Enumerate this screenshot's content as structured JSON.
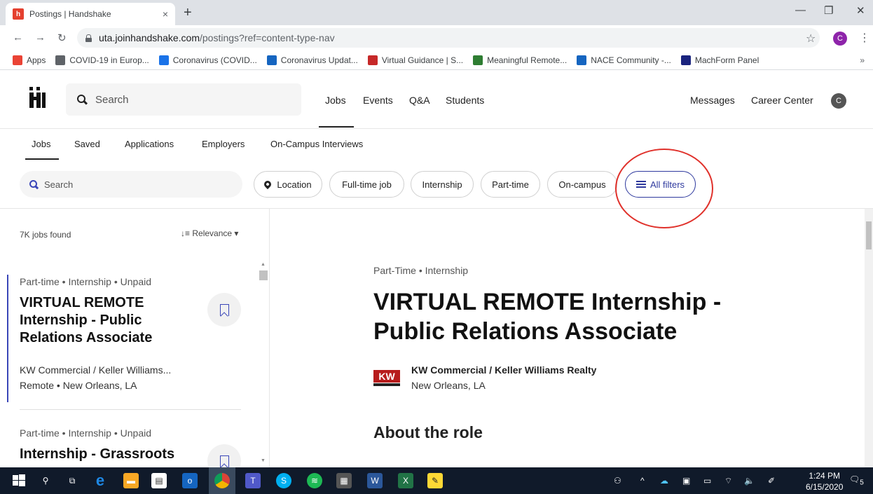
{
  "browser": {
    "tab_title": "Postings | Handshake",
    "tab_close": "×",
    "new_tab": "+",
    "url_domain": "uta.joinhandshake.com",
    "url_path": "/postings?ref=content-type-nav",
    "profile_initial": "C",
    "bookmarks": [
      {
        "label": "Apps",
        "icon": "apps-grid-icon",
        "color": "#ea4335"
      },
      {
        "label": "COVID-19 in Europ...",
        "icon": "globe-icon",
        "color": "#5f6368"
      },
      {
        "label": "Coronavirus (COVID...",
        "icon": "who-icon",
        "color": "#1a73e8"
      },
      {
        "label": "Coronavirus Updat...",
        "icon": "star-badge-icon",
        "color": "#1565c0"
      },
      {
        "label": "Virtual Guidance | S...",
        "icon": "shield-icon",
        "color": "#c62828"
      },
      {
        "label": "Meaningful Remote...",
        "icon": "state-icon",
        "color": "#2e7d32"
      },
      {
        "label": "NACE Community -...",
        "icon": "nace-icon",
        "color": "#1565c0"
      },
      {
        "label": "MachForm Panel",
        "icon": "machform-icon",
        "color": "#1a237e"
      }
    ],
    "bookmarks_more": "»"
  },
  "header": {
    "search_placeholder": "Search",
    "nav": [
      "Jobs",
      "Events",
      "Q&A",
      "Students"
    ],
    "messages": "Messages",
    "career_center": "Career Center",
    "avatar_initial": "C"
  },
  "subnav": [
    "Jobs",
    "Saved",
    "Applications",
    "Employers",
    "On-Campus Interviews"
  ],
  "filters": {
    "search_placeholder": "Search",
    "chips": [
      "Location",
      "Full-time job",
      "Internship",
      "Part-time",
      "On-campus"
    ],
    "all_filters": "All filters"
  },
  "list": {
    "count": "7K jobs found",
    "sort_label": "Relevance",
    "jobs": [
      {
        "meta": "Part-time • Internship • Unpaid",
        "title": "VIRTUAL REMOTE Internship - Public Relations Associate",
        "company": "KW Commercial / Keller Williams...",
        "location": "Remote • New Orleans, LA"
      },
      {
        "meta": "Part-time • Internship • Unpaid",
        "title": "Internship - Grassroots",
        "company": "",
        "location": ""
      }
    ]
  },
  "detail": {
    "meta": "Part-Time • Internship",
    "title": "VIRTUAL REMOTE Internship - Public Relations Associate",
    "company_logo_text": "KW",
    "company_name": "KW Commercial / Keller Williams Realty",
    "company_location": "New Orleans, LA",
    "about_heading": "About the role"
  },
  "taskbar": {
    "time": "1:24 PM",
    "date": "6/15/2020",
    "notification_count": "5"
  },
  "colors": {
    "accent": "#2f3a9e",
    "annotation": "#e0312b",
    "tab_favicon": "#e4402f"
  }
}
